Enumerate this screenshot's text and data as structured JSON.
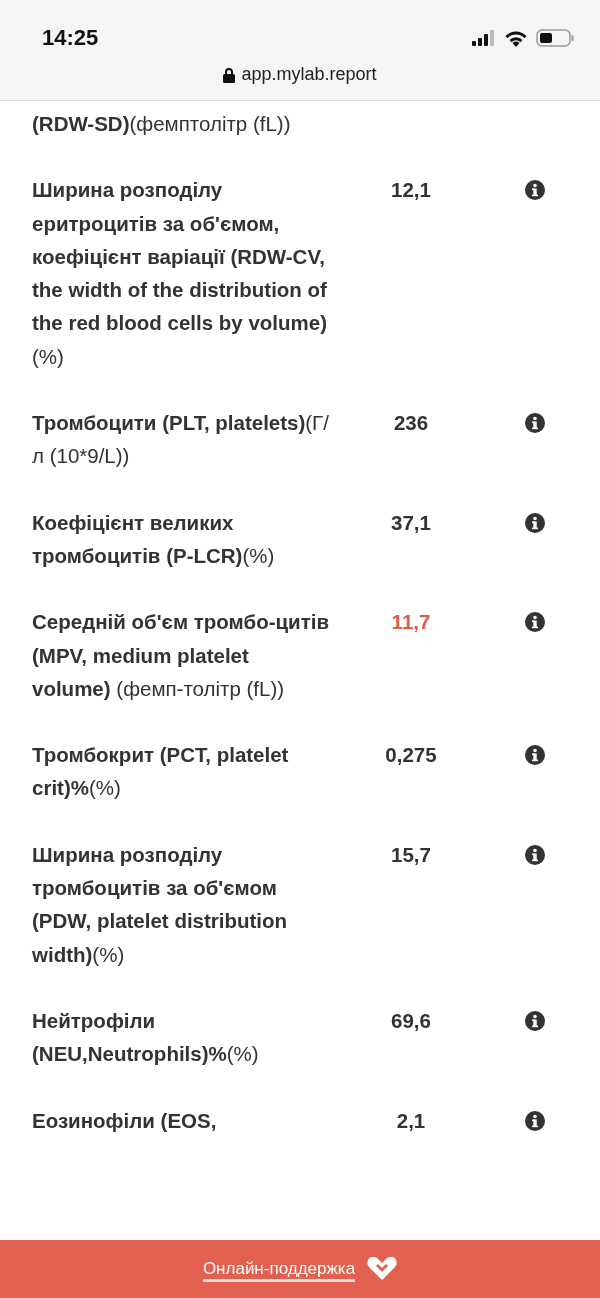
{
  "status_bar": {
    "time": "14:25"
  },
  "address_bar": {
    "url": "app.mylab.report"
  },
  "rows": [
    {
      "name": "**(RDW-SD)**(фемптолітр (fL))"
    },
    {
      "name": "**Ширина розподілу еритроцитів за об'ємом, коефіцієнт варіації (RDW-CV, the width of the distribution of the red blood cells by volume)**(%)",
      "value": "12,1",
      "abnormal": false
    },
    {
      "name": "**Тромбоцити (PLT, platelets)**(Г/л (10*9/L))",
      "value": "236",
      "abnormal": false
    },
    {
      "name": "**Коефіцієнт великих тромбоцитів (P-LCR)**(%)",
      "value": "37,1",
      "abnormal": false
    },
    {
      "name": "**Середній об'єм тромбо-цитів (MPV, medium platelet volume)** (фемп-толітр (fL))",
      "value": "11,7",
      "abnormal": true
    },
    {
      "name": "**Тромбокрит (PCT, platelet crit)%**(%)",
      "value": "0,275",
      "abnormal": false
    },
    {
      "name": "**Ширина розподілу тромбоцитів за об'ємом (PDW, platelet distribution width)**(%)",
      "value": "15,7",
      "abnormal": false
    },
    {
      "name": "**Нейтрофіли (NEU,Neutrophils)%**(%)",
      "value": "69,6",
      "abnormal": false
    },
    {
      "name": "**Еозинофіли (EOS,**",
      "value": "2,1",
      "abnormal": false
    }
  ],
  "support_bar": {
    "label": "Онлайн-поддержка"
  }
}
